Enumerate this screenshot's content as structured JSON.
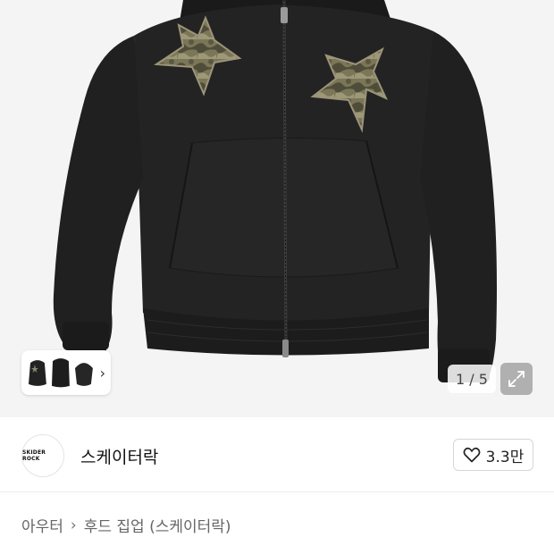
{
  "gallery": {
    "counter": "1 / 5",
    "image_alt": "black zip-up hoodie with camouflage star patches",
    "thumbnails": [
      "hoodie-front",
      "hoodie-back",
      "hoodie-hood"
    ],
    "next_icon": "chevron-right-icon",
    "expand_icon": "expand-icon"
  },
  "seller": {
    "avatar_text": "SKIDER ROCK",
    "name": "스케이터락"
  },
  "like": {
    "icon": "heart-icon",
    "count": "3.3만"
  },
  "breadcrumb": {
    "items": [
      "아우터",
      "후드 집업 (스케이터락)"
    ],
    "separator": "›"
  },
  "colors": {
    "hoodie": "#1f1f20",
    "camo": "#6d6a4f",
    "background": "#f4f4f4"
  }
}
